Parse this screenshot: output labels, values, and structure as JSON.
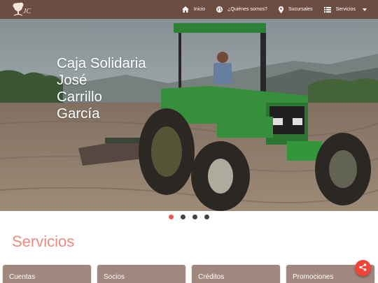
{
  "navbar": {
    "logo_text": "JC",
    "items": [
      {
        "label": "Inicio",
        "icon": "home-icon"
      },
      {
        "label": "¿Quiénes somos?",
        "icon": "globe-icon"
      },
      {
        "label": "Sucursales",
        "icon": "location-pin-icon"
      },
      {
        "label": "Servicios",
        "icon": "list-icon"
      }
    ]
  },
  "hero": {
    "title_lines": [
      "Caja Solidaria",
      "José",
      "Carrillo",
      "García"
    ]
  },
  "carousel": {
    "slide_count": 4,
    "active_index": 0
  },
  "section": {
    "title": "Servicios",
    "cards": [
      "Cuentas",
      "Socios",
      "Créditos",
      "Promociones"
    ]
  },
  "colors": {
    "navbar": "#6d4c41",
    "accent": "#ef5350",
    "section_title": "#ef8a80",
    "card": "#a1887f"
  }
}
